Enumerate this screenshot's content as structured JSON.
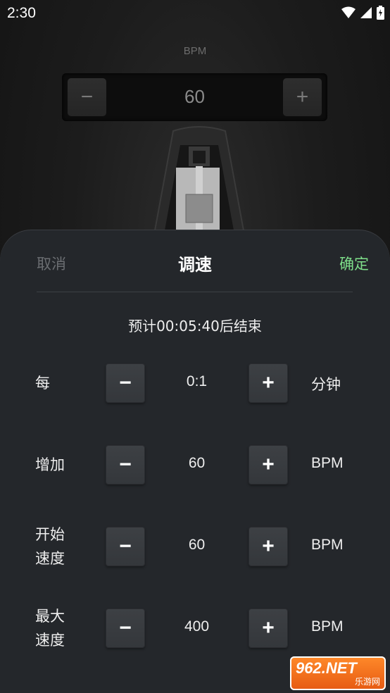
{
  "status_bar": {
    "time": "2:30"
  },
  "metronome": {
    "bpm_label": "BPM",
    "bpm_value": "60",
    "minus": "−",
    "plus": "+"
  },
  "sheet": {
    "cancel": "取消",
    "title": "调速",
    "confirm": "确定",
    "estimate": "预计00:05:40后结束",
    "rows": [
      {
        "label": "每",
        "value": "0:1",
        "unit": "分钟"
      },
      {
        "label": "增加",
        "value": "60",
        "unit": "BPM"
      },
      {
        "label": "开始速度",
        "label_line1": "开始",
        "label_line2": "速度",
        "value": "60",
        "unit": "BPM"
      },
      {
        "label": "最大速度",
        "label_line1": "最大",
        "label_line2": "速度",
        "value": "400",
        "unit": "BPM"
      }
    ],
    "minus": "−",
    "plus": "+"
  },
  "watermark": {
    "main": "962.NET",
    "sub": "乐游网"
  },
  "colors": {
    "accent": "#7ede8a",
    "sheet_bg": "#24272b"
  }
}
